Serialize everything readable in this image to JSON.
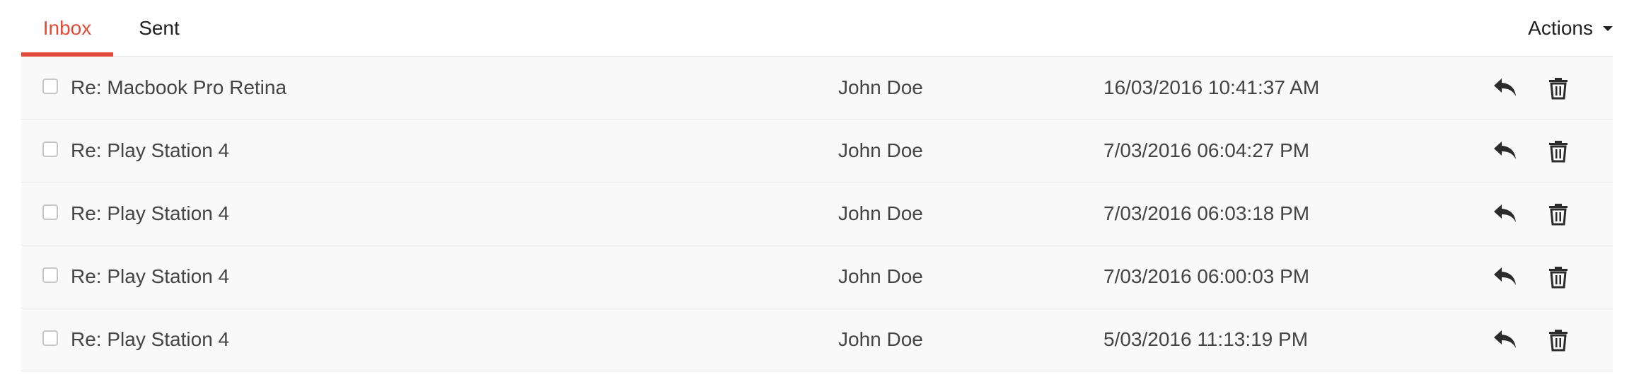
{
  "tabs": {
    "inbox": "Inbox",
    "sent": "Sent"
  },
  "actions": {
    "label": "Actions"
  },
  "colors": {
    "accent": "#e04b3a",
    "row_background": "#f9f9f9"
  },
  "messages": [
    {
      "subject": "Re: Macbook Pro Retina",
      "sender": "John Doe",
      "date": "16/03/2016 10:41:37 AM"
    },
    {
      "subject": "Re: Play Station 4",
      "sender": "John Doe",
      "date": "7/03/2016 06:04:27 PM"
    },
    {
      "subject": "Re: Play Station 4",
      "sender": "John Doe",
      "date": "7/03/2016 06:03:18 PM"
    },
    {
      "subject": "Re: Play Station 4",
      "sender": "John Doe",
      "date": "7/03/2016 06:00:03 PM"
    },
    {
      "subject": "Re: Play Station 4",
      "sender": "John Doe",
      "date": "5/03/2016 11:13:19 PM"
    }
  ],
  "icons": {
    "reply": "reply-icon",
    "delete": "trash-icon",
    "dropdown": "caret-down-icon"
  }
}
